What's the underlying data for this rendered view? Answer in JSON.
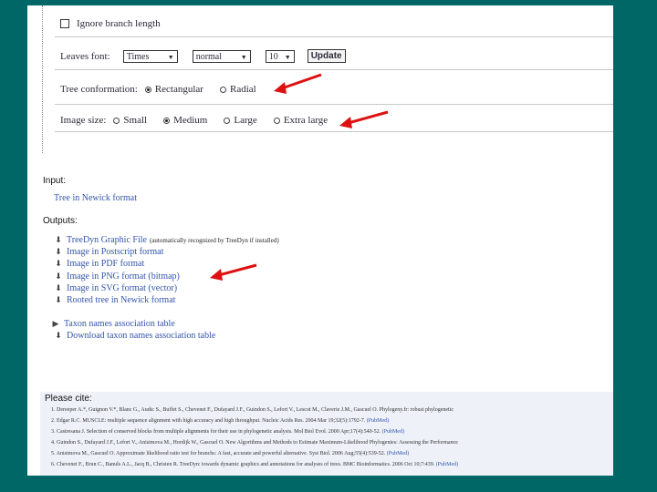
{
  "options": {
    "ignore_branch_length": "Ignore branch length",
    "leaves_font": {
      "label": "Leaves font:",
      "family": "Times",
      "style": "normal",
      "size": "10",
      "update": "Update"
    },
    "tree_conformation": {
      "label": "Tree conformation:",
      "choices": [
        "Rectangular",
        "Radial"
      ],
      "selected": "Rectangular"
    },
    "image_size": {
      "label": "Image size:",
      "choices": [
        "Small",
        "Medium",
        "Large",
        "Extra large"
      ],
      "selected": "Medium"
    }
  },
  "input": {
    "heading": "Input:",
    "link": "Tree in Newick format"
  },
  "outputs": {
    "heading": "Outputs:",
    "links": [
      "TreeDyn Graphic File",
      "Image in Postscript format",
      "Image in PDF format",
      "Image in PNG format (bitmap)",
      "Image in SVG format (vector)",
      "Rooted tree in Newick format"
    ],
    "treedyn_note": "(automatically recognized by TreeDyn if installed)",
    "taxon_links": [
      "Taxon names association table",
      "Download taxon names association table"
    ]
  },
  "citations": {
    "heading": "Please cite:",
    "refs": [
      {
        "text": "1. Dereeper A.*, Guignon V.*, Blanc G., Audic S., Buffet S., Chevenet F., Dufayard J.F., Guindon S., Lefort V., Lescot M., Claverie J.M., Gascuel O. Phylogeny.fr: robust phylogenetic",
        "link": ""
      },
      {
        "text": "2. Edgar R.C. MUSCLE: multiple sequence alignment with high accuracy and high throughput. Nucleic Acids Res. 2004 Mar 19;32(5):1792-7.",
        "link": "(PubMed)"
      },
      {
        "text": "3. Castresana J. Selection of conserved blocks from multiple alignments for their use in phylogenetic analysis. Mol Biol Evol. 2000 Apr;17(4):540-52.",
        "link": "(PubMed)"
      },
      {
        "text": "4. Guindon S., Dufayard J.F., Lefort V., Anisimova M., Hordijk W., Gascuel O. New Algorithms and Methods to Estimate Maximum-Likelihood Phylogenies: Assessing the Performance",
        "link": ""
      },
      {
        "text": "5. Anisimova M., Gascuel O. Approximate likelihood ratio test for branchs: A fast, accurate and powerful alternative. Syst Biol. 2006 Aug;55(4):539-52.",
        "link": "(PubMed)"
      },
      {
        "text": "6. Chevenet F., Brun C., Banuls A.L., Jacq B., Christen R. TreeDyn: towards dynamic graphics and annotations for analyses of trees. BMC Bioinformatics. 2006 Oct 10;7:439.",
        "link": "(PubMed)"
      }
    ]
  },
  "colors": {
    "background": "#006666",
    "link": "#3355aa",
    "arrow": "#dd1111"
  }
}
